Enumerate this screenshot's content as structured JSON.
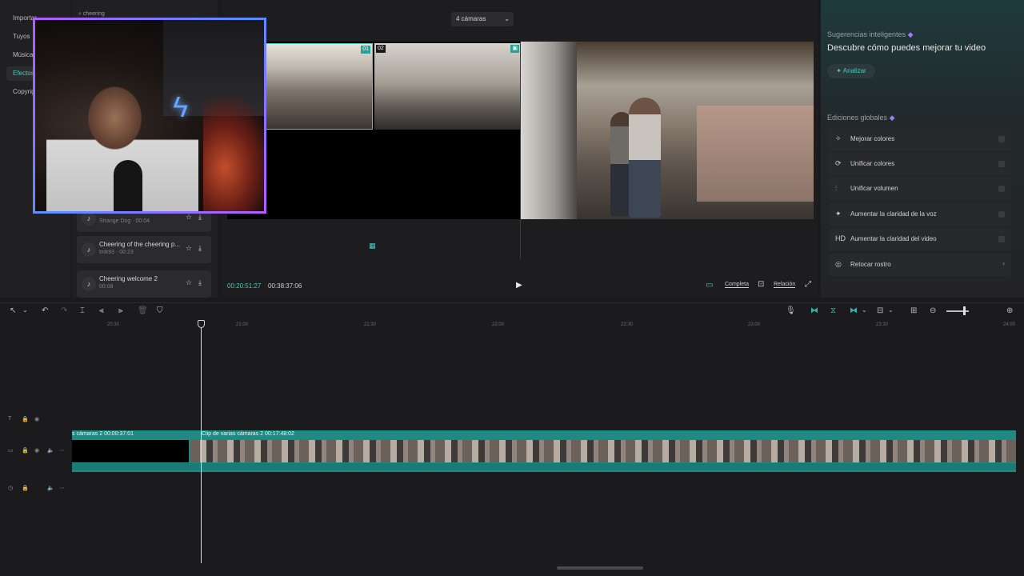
{
  "left_nav": {
    "items": [
      {
        "label": "Importar",
        "active": false
      },
      {
        "label": "Tuyos",
        "active": false
      },
      {
        "label": "Música",
        "active": false
      },
      {
        "label": "Efectos",
        "active": true
      },
      {
        "label": "Copyright",
        "active": false
      }
    ]
  },
  "media_search": {
    "value": "cheering"
  },
  "media_list": [
    {
      "title": "",
      "sub": "Strange Dog · 00:04"
    },
    {
      "title": "Cheering of the cheering p...",
      "sub": "tmk93 · 00:23"
    },
    {
      "title": "Cheering welcome 2",
      "sub": "00:08"
    }
  ],
  "player": {
    "camera_select": "4 cámaras",
    "cam_badge_1": "01",
    "cam_badge_2": "02",
    "time_current": "00:20:51:27",
    "time_total": "00:38:37:06",
    "quality_label": "Completa",
    "ratio_label": "Relación"
  },
  "suggestions": {
    "label": "Sugerencias inteligentes",
    "title": "Descubre cómo puedes mejorar tu video",
    "analyze_label": "Analizar",
    "global_label": "Ediciones globales",
    "options": [
      {
        "icon": "✧",
        "label": "Mejorar colores"
      },
      {
        "icon": "⟳",
        "label": "Unificar colores"
      },
      {
        "icon": "⫶",
        "label": "Unificar volumen"
      },
      {
        "icon": "✦",
        "label": "Aumentar la claridad de la voz"
      },
      {
        "icon": "HD",
        "label": "Aumentar la claridad del video"
      },
      {
        "icon": "◎",
        "label": "Retocar rostro"
      }
    ]
  },
  "timeline": {
    "ticks": [
      "20:30",
      "21:00",
      "21:30",
      "22:00",
      "22:30",
      "23:00",
      "23:30",
      "24:00"
    ],
    "clip_1_label": "s cámaras 2   00:00:37:01",
    "clip_2_label": "Clip de varias cámaras 2   00:17:48:02"
  },
  "colors": {
    "accent": "#4fc7bd",
    "clip": "#1f8a83"
  }
}
